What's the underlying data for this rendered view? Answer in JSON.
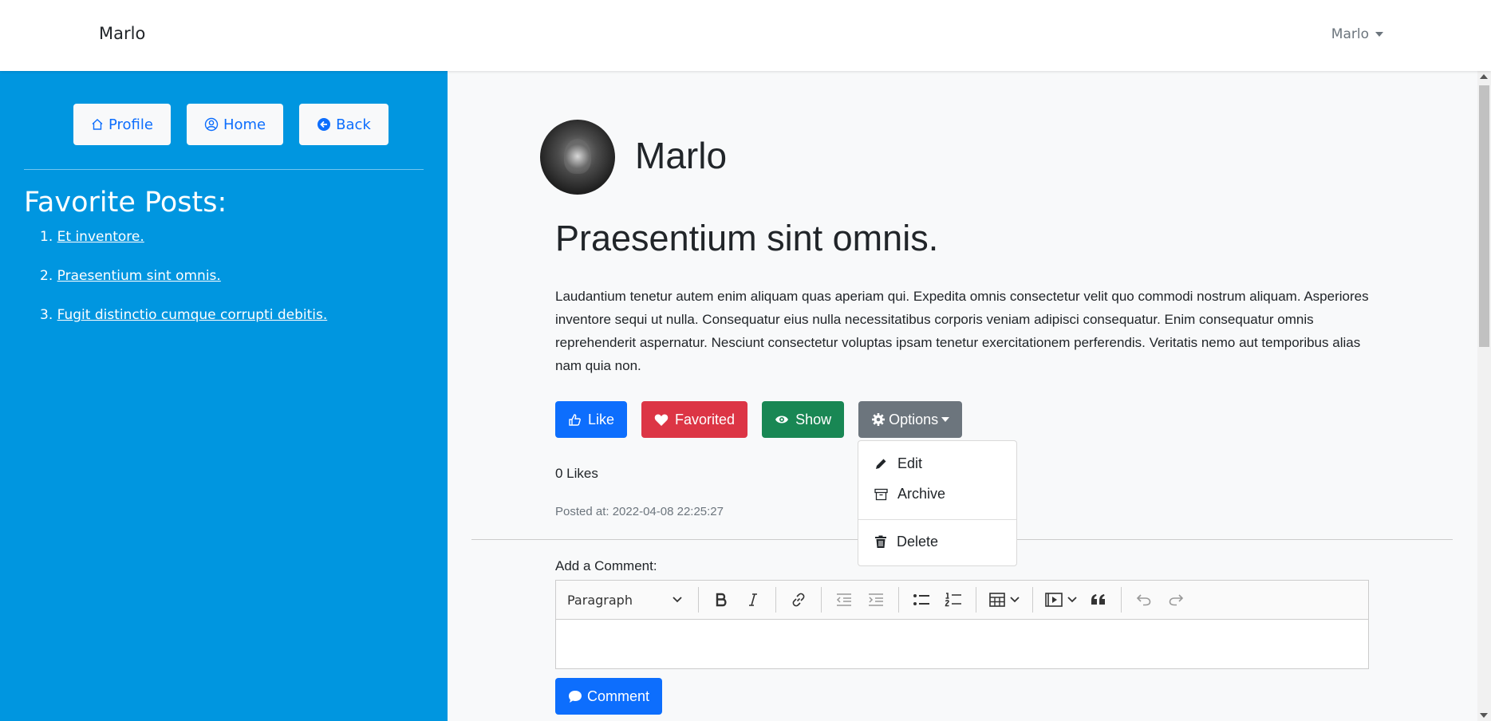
{
  "navbar": {
    "brand": "Marlo",
    "user_menu": "Marlo"
  },
  "sidebar": {
    "buttons": [
      {
        "label": "Profile",
        "icon": "house-icon"
      },
      {
        "label": "Home",
        "icon": "person-circle-icon"
      },
      {
        "label": "Back",
        "icon": "arrow-left-circle-icon"
      }
    ],
    "favorites_title": "Favorite Posts:",
    "favorites": [
      {
        "num": "1.",
        "title": "Et inventore."
      },
      {
        "num": "2.",
        "title": "Praesentium sint omnis."
      },
      {
        "num": "3.",
        "title": "Fugit distinctio cumque corrupti debitis."
      }
    ]
  },
  "post": {
    "author": "Marlo",
    "title": "Praesentium sint omnis.",
    "body": "Laudantium tenetur autem enim aliquam quas aperiam qui. Expedita omnis consectetur velit quo commodi nostrum aliquam. Asperiores inventore sequi ut nulla. Consequatur eius nulla necessitatibus corporis veniam adipisci consequatur. Enim consequatur omnis reprehenderit aspernatur. Nesciunt consectetur voluptas ipsam tenetur exercitationem perferendis. Veritatis nemo aut temporibus alias nam quia non.",
    "actions": {
      "like": "Like",
      "favorited": "Favorited",
      "show": "Show",
      "options": "Options"
    },
    "likes": "0 Likes",
    "posted_at": "Posted at: 2022-04-08 22:25:27"
  },
  "options_menu": {
    "edit": "Edit",
    "archive": "Archive",
    "delete": "Delete"
  },
  "comment": {
    "label": "Add a Comment:",
    "heading_select": "Paragraph",
    "submit": "Comment"
  },
  "colors": {
    "sidebar": "#0096e0",
    "primary": "#0d6efd",
    "danger": "#dc3545",
    "success": "#198754",
    "secondary": "#6c757d"
  }
}
